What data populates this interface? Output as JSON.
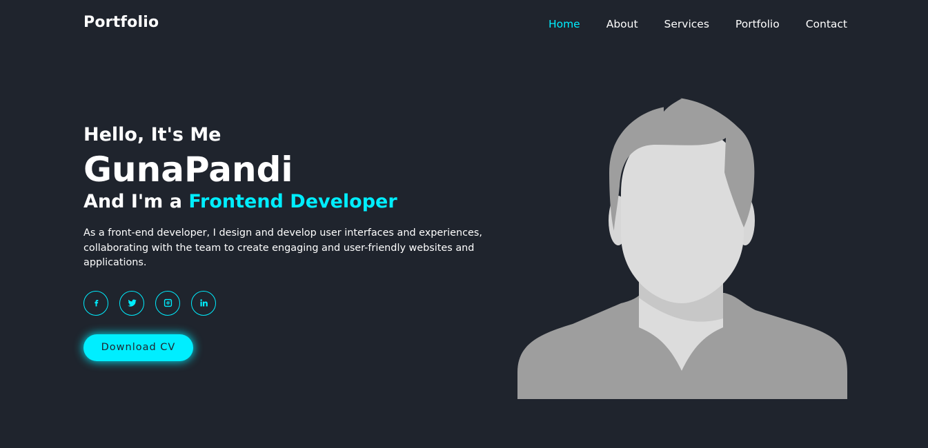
{
  "header": {
    "logo": "Portfolio",
    "nav": [
      {
        "label": "Home",
        "active": true
      },
      {
        "label": "About"
      },
      {
        "label": "Services"
      },
      {
        "label": "Portfolio"
      },
      {
        "label": "Contact"
      }
    ]
  },
  "hero": {
    "greeting": "Hello, It's Me",
    "name": "GunaPandi",
    "role_prefix": "And I'm a ",
    "role_highlight": "Frontend Developer",
    "description": "As a front-end developer, I design and develop user interfaces and experiences, collaborating with the team to create engaging and user-friendly websites and applications.",
    "social": [
      "facebook-icon",
      "twitter-icon",
      "instagram-icon",
      "linkedin-icon"
    ],
    "cta_label": "Download CV"
  },
  "colors": {
    "background": "#1f242d",
    "accent": "#00eeff",
    "text": "#ffffff"
  }
}
